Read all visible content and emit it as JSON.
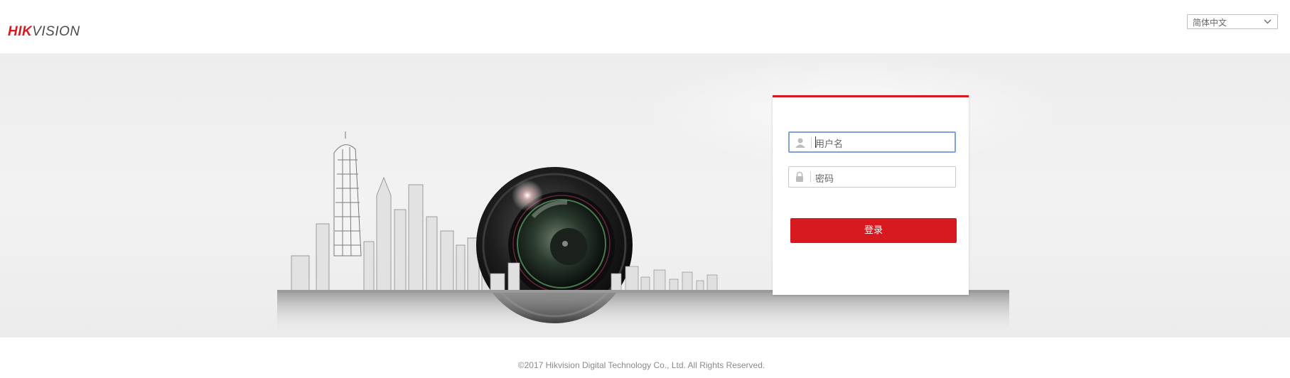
{
  "header": {
    "logo_hik": "HIK",
    "logo_vision": "VISION",
    "language_select": {
      "selected": "简体中文",
      "icon": "chevron-down-icon"
    }
  },
  "login": {
    "username_placeholder": "用户名",
    "password_placeholder": "密码",
    "login_label": "登录",
    "username_icon": "user-icon",
    "password_icon": "lock-icon"
  },
  "footer": {
    "copyright": "©2017 Hikvision Digital Technology Co., Ltd. All Rights Reserved."
  },
  "colors": {
    "brand_red": "#d71920",
    "focus_border": "#7fa3d8",
    "banner_bg": "#ededed"
  }
}
